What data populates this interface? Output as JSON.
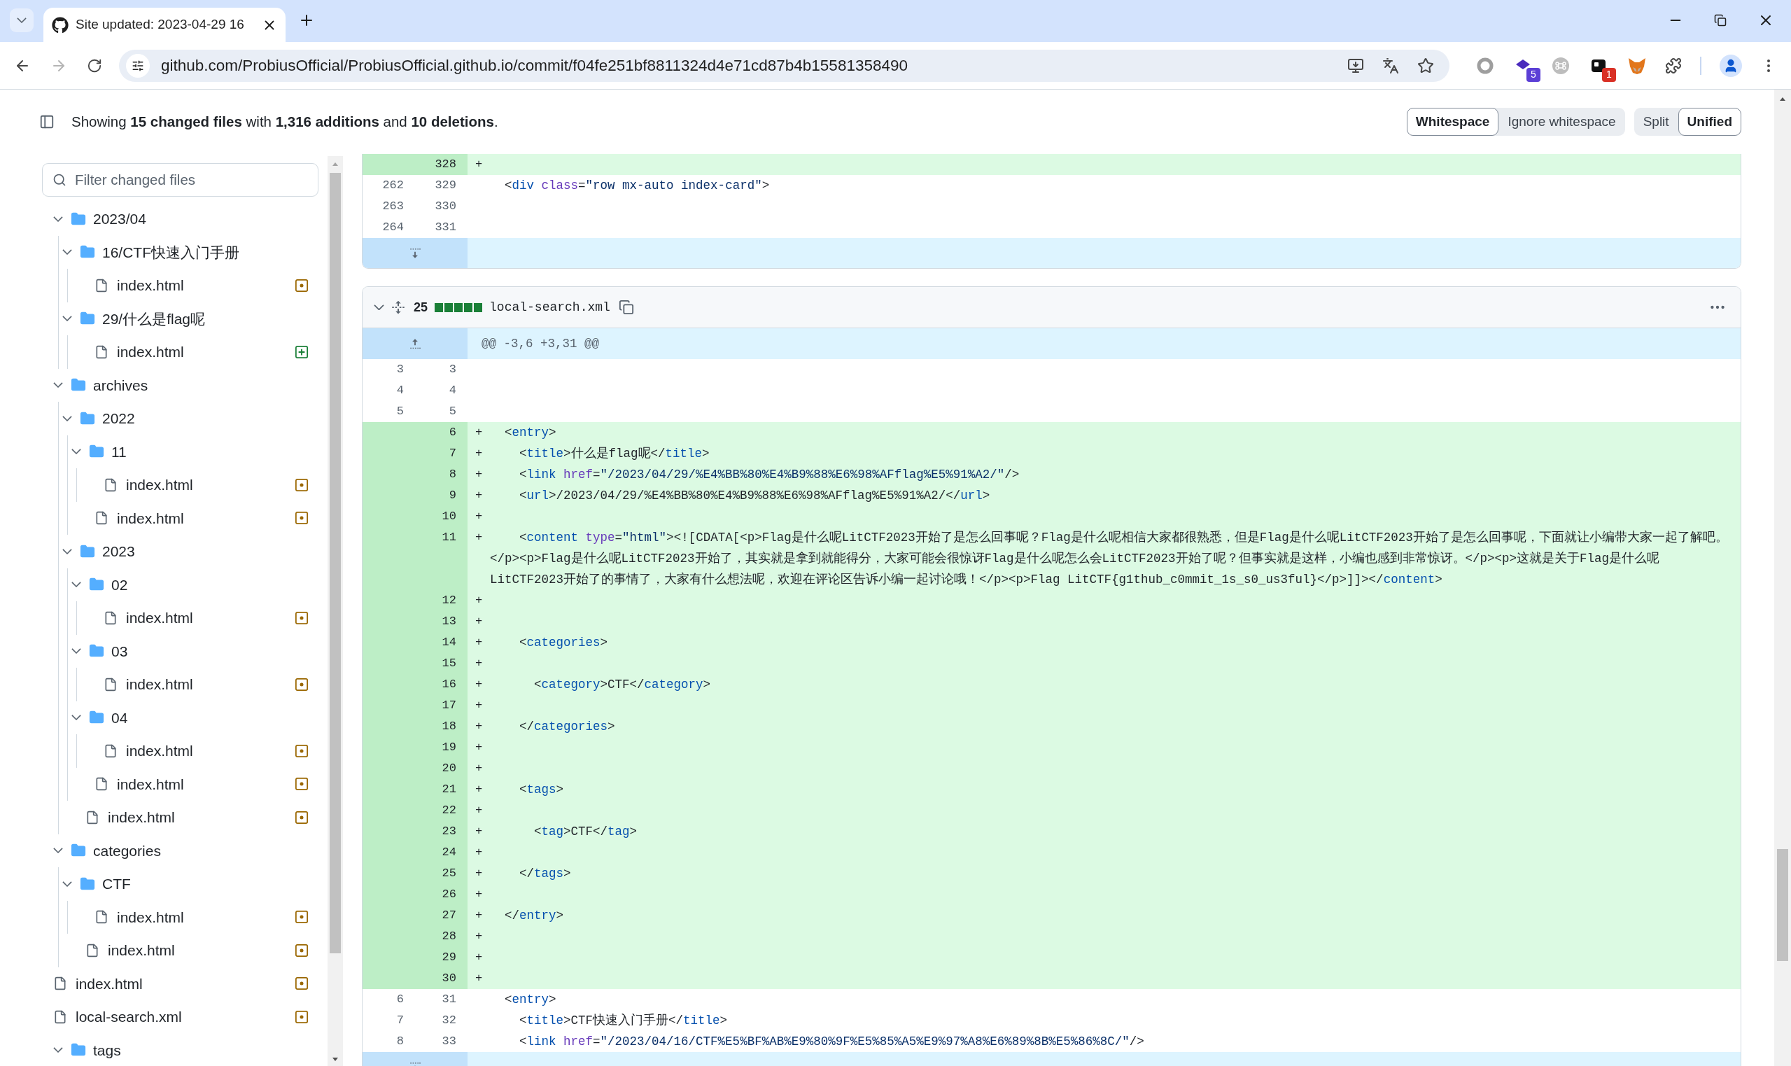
{
  "browser": {
    "tab_title": "Site updated: 2023-04-29 16",
    "url": "github.com/ProbiusOfficial/ProbiusOfficial.github.io/commit/f04fe251bf8811324d4e71cd87b4b15581358490",
    "extension_badges": [
      "5",
      "1"
    ]
  },
  "header": {
    "summary": "Showing **15 changed files** with **1,316 additions** and **10 deletions**.",
    "whitespace_buttons": [
      {
        "label": "Whitespace",
        "selected": true
      },
      {
        "label": "Ignore whitespace",
        "selected": false
      }
    ],
    "view_buttons": [
      {
        "label": "Split",
        "selected": false
      },
      {
        "label": "Unified",
        "selected": true
      }
    ]
  },
  "sidebar": {
    "filter_placeholder": "Filter changed files",
    "tree": [
      {
        "kind": "folder",
        "name": "2023/04",
        "expanded": true,
        "children": [
          {
            "kind": "folder",
            "name": "16/CTF快速入门手册",
            "expanded": true,
            "children": [
              {
                "kind": "file",
                "name": "index.html",
                "added": false
              }
            ]
          },
          {
            "kind": "folder",
            "name": "29/什么是flag呢",
            "expanded": true,
            "children": [
              {
                "kind": "file",
                "name": "index.html",
                "added": true
              }
            ]
          }
        ]
      },
      {
        "kind": "folder",
        "name": "archives",
        "expanded": true,
        "children": [
          {
            "kind": "folder",
            "name": "2022",
            "expanded": true,
            "children": [
              {
                "kind": "folder",
                "name": "11",
                "expanded": true,
                "children": [
                  {
                    "kind": "file",
                    "name": "index.html",
                    "added": false
                  }
                ]
              },
              {
                "kind": "file",
                "name": "index.html",
                "added": false
              }
            ]
          },
          {
            "kind": "folder",
            "name": "2023",
            "expanded": true,
            "children": [
              {
                "kind": "folder",
                "name": "02",
                "expanded": true,
                "children": [
                  {
                    "kind": "file",
                    "name": "index.html",
                    "added": false
                  }
                ]
              },
              {
                "kind": "folder",
                "name": "03",
                "expanded": true,
                "children": [
                  {
                    "kind": "file",
                    "name": "index.html",
                    "added": false
                  }
                ]
              },
              {
                "kind": "folder",
                "name": "04",
                "expanded": true,
                "children": [
                  {
                    "kind": "file",
                    "name": "index.html",
                    "added": false
                  }
                ]
              },
              {
                "kind": "file",
                "name": "index.html",
                "added": false
              }
            ]
          },
          {
            "kind": "file",
            "name": "index.html",
            "added": false
          }
        ]
      },
      {
        "kind": "folder",
        "name": "categories",
        "expanded": true,
        "children": [
          {
            "kind": "folder",
            "name": "CTF",
            "expanded": true,
            "children": [
              {
                "kind": "file",
                "name": "index.html",
                "added": false
              }
            ]
          },
          {
            "kind": "file",
            "name": "index.html",
            "added": false
          }
        ]
      },
      {
        "kind": "file",
        "name": "index.html",
        "added": false
      },
      {
        "kind": "file",
        "name": "local-search.xml",
        "added": false
      },
      {
        "kind": "folder",
        "name": "tags",
        "expanded": true
      }
    ]
  },
  "diffs": [
    {
      "lines": [
        {
          "kind": "added",
          "new": "328",
          "sign": "+"
        },
        {
          "kind": "context",
          "old": "262",
          "new": "329",
          "code": "  <div class=\"row mx-auto index-card\">"
        },
        {
          "kind": "context",
          "old": "263",
          "new": "330"
        },
        {
          "kind": "context",
          "old": "264",
          "new": "331"
        },
        {
          "kind": "expand"
        }
      ]
    },
    {
      "file": {
        "changes": "25",
        "name": "local-search.xml"
      },
      "lines": [
        {
          "kind": "hunk",
          "code": "@@ -3,6 +3,31 @@"
        },
        {
          "kind": "context",
          "old": "3",
          "new": "3"
        },
        {
          "kind": "context",
          "old": "4",
          "new": "4"
        },
        {
          "kind": "context",
          "old": "5",
          "new": "5"
        },
        {
          "kind": "added",
          "new": "6",
          "sign": "+",
          "code": "  <entry>"
        },
        {
          "kind": "added",
          "new": "7",
          "sign": "+",
          "code": "    <title>什么是flag呢</title>"
        },
        {
          "kind": "added",
          "new": "8",
          "sign": "+",
          "code": "    <link href=\"/2023/04/29/%E4%BB%80%E4%B9%88%E6%98%AFflag%E5%91%A2/\"/>"
        },
        {
          "kind": "added",
          "new": "9",
          "sign": "+",
          "code": "    <url>/2023/04/29/%E4%BB%80%E4%B9%88%E6%98%AFflag%E5%91%A2/</url>"
        },
        {
          "kind": "added",
          "new": "10",
          "sign": "+"
        },
        {
          "kind": "added",
          "new": "11",
          "sign": "+",
          "code": "    <content type=\"html\"><![CDATA[<p>Flag是什么呢LitCTF2023开始了是怎么回事呢？Flag是什么呢相信大家都很熟悉，但是Flag是什么呢LitCTF2023开始了是怎么回事呢，下面就让小编带大家一起了解吧。</p><p>Flag是什么呢LitCTF2023开始了，其实就是拿到就能得分，大家可能会很惊讶Flag是什么呢怎么会LitCTF2023开始了呢？但事实就是这样，小编也感到非常惊讶。</p><p>这就是关于Flag是什么呢LitCTF2023开始了的事情了，大家有什么想法呢，欢迎在评论区告诉小编一起讨论哦！</p><p>Flag LitCTF{g1thub_c0mmit_1s_s0_us3ful}</p>]]></content>"
        },
        {
          "kind": "added",
          "new": "12",
          "sign": "+"
        },
        {
          "kind": "added",
          "new": "13",
          "sign": "+"
        },
        {
          "kind": "added",
          "new": "14",
          "sign": "+",
          "code": "    <categories>"
        },
        {
          "kind": "added",
          "new": "15",
          "sign": "+"
        },
        {
          "kind": "added",
          "new": "16",
          "sign": "+",
          "code": "      <category>CTF</category>"
        },
        {
          "kind": "added",
          "new": "17",
          "sign": "+"
        },
        {
          "kind": "added",
          "new": "18",
          "sign": "+",
          "code": "    </categories>"
        },
        {
          "kind": "added",
          "new": "19",
          "sign": "+"
        },
        {
          "kind": "added",
          "new": "20",
          "sign": "+"
        },
        {
          "kind": "added",
          "new": "21",
          "sign": "+",
          "code": "    <tags>"
        },
        {
          "kind": "added",
          "new": "22",
          "sign": "+"
        },
        {
          "kind": "added",
          "new": "23",
          "sign": "+",
          "code": "      <tag>CTF</tag>"
        },
        {
          "kind": "added",
          "new": "24",
          "sign": "+"
        },
        {
          "kind": "added",
          "new": "25",
          "sign": "+",
          "code": "    </tags>"
        },
        {
          "kind": "added",
          "new": "26",
          "sign": "+"
        },
        {
          "kind": "added",
          "new": "27",
          "sign": "+",
          "code": "  </entry>"
        },
        {
          "kind": "added",
          "new": "28",
          "sign": "+"
        },
        {
          "kind": "added",
          "new": "29",
          "sign": "+"
        },
        {
          "kind": "added",
          "new": "30",
          "sign": "+"
        },
        {
          "kind": "context",
          "old": "6",
          "new": "31",
          "code": "  <entry>"
        },
        {
          "kind": "context",
          "old": "7",
          "new": "32",
          "code": "    <title>CTF快速入门手册</title>"
        },
        {
          "kind": "context",
          "old": "8",
          "new": "33",
          "code": "    <link href=\"/2023/04/16/CTF%E5%BF%AB%E9%80%9F%E5%85%A5%E9%97%A8%E6%89%8B%E5%86%8C/\"/>"
        },
        {
          "kind": "expand"
        }
      ]
    }
  ]
}
